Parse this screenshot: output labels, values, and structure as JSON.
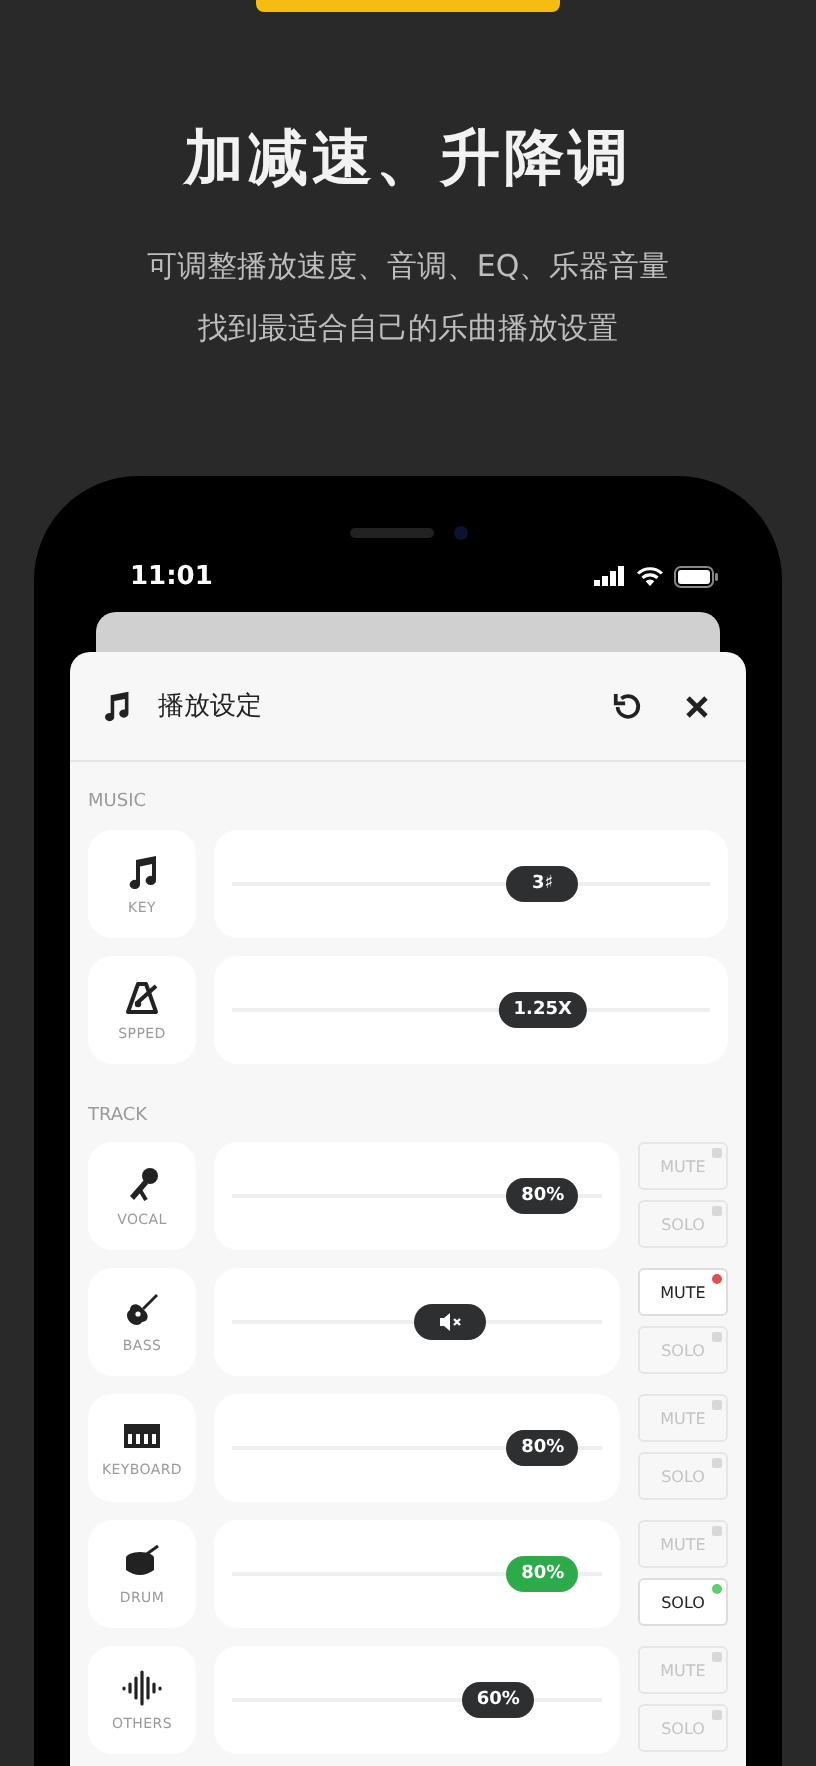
{
  "headline": "加减速、升降调",
  "subtitle_lines": [
    "可调整播放速度、音调、EQ、乐器音量",
    "找到最适合自己的乐曲播放设置"
  ],
  "status_bar": {
    "time": "11:01"
  },
  "sheet": {
    "title": "播放设定"
  },
  "music": {
    "label": "MUSIC",
    "rows": [
      {
        "name": "KEY",
        "level": 0.65,
        "reading": "3♯"
      },
      {
        "name": "SPPED",
        "level": 0.65,
        "reading": "1.25X"
      }
    ]
  },
  "track": {
    "label": "TRACK",
    "rows": [
      {
        "name": "VOCAL",
        "level": 0.84,
        "reading": "80%",
        "mute_label": "MUTE",
        "mute": false,
        "solo_label": "SOLO",
        "solo": false
      },
      {
        "name": "BASS",
        "level": 0.59,
        "mute_label": "MUTE",
        "mute": true,
        "solo_label": "SOLO",
        "solo": false
      },
      {
        "name": "KEYBOARD",
        "level": 0.84,
        "reading": "80%",
        "mute_label": "MUTE",
        "mute": false,
        "solo_label": "SOLO",
        "solo": false
      },
      {
        "name": "DRUM",
        "level": 0.84,
        "reading": "80%",
        "mute_label": "MUTE",
        "mute": false,
        "solo_label": "SOLO",
        "solo": true
      },
      {
        "name": "OTHERS",
        "level": 0.72,
        "reading": "60%",
        "mute_label": "MUTE",
        "mute": false,
        "solo_label": "SOLO",
        "solo": false
      }
    ]
  }
}
